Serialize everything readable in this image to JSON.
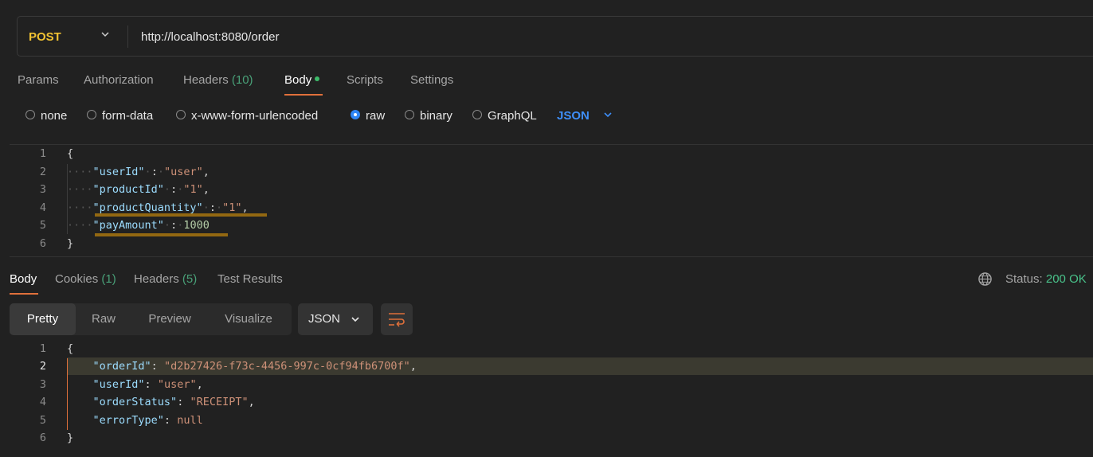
{
  "request": {
    "method": "POST",
    "url": "http://localhost:8080/order"
  },
  "request_tabs": {
    "params": "Params",
    "authorization": "Authorization",
    "headers": "Headers",
    "headers_count": "(10)",
    "body": "Body",
    "scripts": "Scripts",
    "settings": "Settings"
  },
  "body_types": {
    "none": "none",
    "form_data": "form-data",
    "urlencoded": "x-www-form-urlencoded",
    "raw": "raw",
    "binary": "binary",
    "graphql": "GraphQL",
    "selected": "raw",
    "format": "JSON"
  },
  "request_body": {
    "line_numbers": [
      "1",
      "2",
      "3",
      "4",
      "5",
      "6"
    ],
    "open": "{",
    "close": "}",
    "k1": "\"userId\"",
    "v1": "\"user\"",
    "k2": "\"productId\"",
    "v2": "\"1\"",
    "k3": "\"productQuantity\"",
    "v3": "\"1\"",
    "k4": "\"payAmount\"",
    "v4": "1000"
  },
  "response_tabs": {
    "body": "Body",
    "cookies": "Cookies",
    "cookies_count": "(1)",
    "headers": "Headers",
    "headers_count": "(5)",
    "test_results": "Test Results"
  },
  "status": {
    "label": "Status:",
    "value": "200 OK"
  },
  "view_modes": {
    "pretty": "Pretty",
    "raw": "Raw",
    "preview": "Preview",
    "visualize": "Visualize",
    "format": "JSON"
  },
  "response_body": {
    "line_numbers": [
      "1",
      "2",
      "3",
      "4",
      "5",
      "6"
    ],
    "current_line": "2",
    "open": "{",
    "close": "}",
    "k1": "\"orderId\"",
    "v1": "\"d2b27426-f73c-4456-997c-0cf94fb6700f\"",
    "k2": "\"userId\"",
    "v2": "\"user\"",
    "k3": "\"orderStatus\"",
    "v3": "\"RECEIPT\"",
    "k4": "\"errorType\"",
    "v4": "null"
  },
  "colors": {
    "method": "#f1c232",
    "accent": "#e0703b",
    "json_key": "#9cdcfe",
    "json_string": "#ce9178",
    "status_ok": "#49c28a"
  },
  "icons": [
    "chevron-down-icon",
    "globe-icon",
    "wrap-lines-icon"
  ]
}
